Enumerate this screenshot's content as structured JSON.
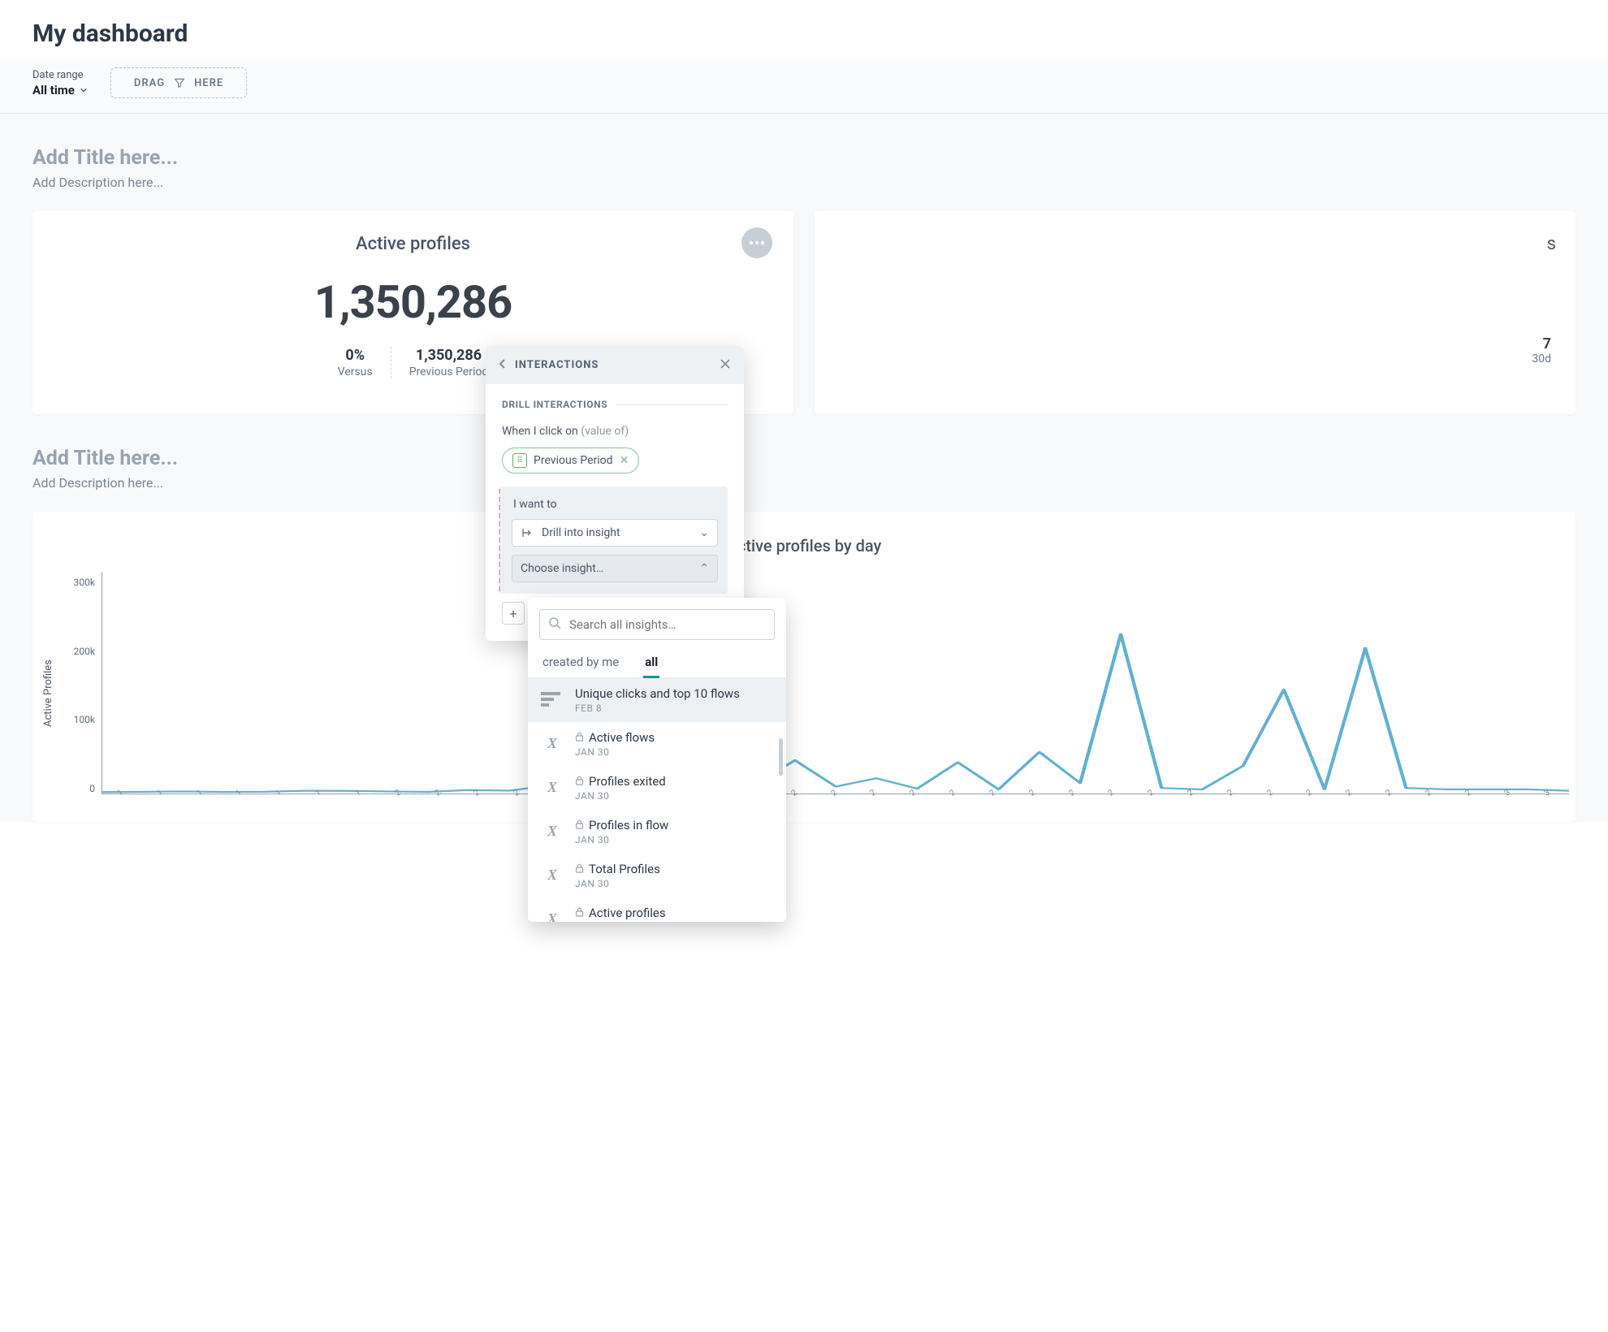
{
  "header": {
    "title": "My dashboard"
  },
  "filters": {
    "date_range_label": "Date range",
    "date_range_value": "All time",
    "drag_left": "DRAG",
    "drag_right": "HERE"
  },
  "section1": {
    "title_placeholder": "Add Title here...",
    "desc_placeholder": "Add Description here..."
  },
  "kpi_card": {
    "title": "Active profiles",
    "value": "1,350,286",
    "versus_pct": "0%",
    "versus_label": "Versus",
    "prev_value": "1,350,286",
    "prev_label": "Previous Period"
  },
  "kpi_card2": {
    "title_suffix": "s",
    "num_right": "7",
    "label_right": "30d"
  },
  "section2": {
    "title_placeholder": "Add Title here...",
    "desc_placeholder": "Add Description here..."
  },
  "chart_title": "Active profiles by day",
  "chart_y_label": "Active Profiles",
  "popover": {
    "title": "INTERACTIONS",
    "section_label": "DRILL INTERACTIONS",
    "when_text": "When I click on",
    "when_muted": "(value of)",
    "chip_label": "Previous Period",
    "i_want_to": "I want to",
    "action_value": "Drill into insight",
    "choose_label": "Choose insight…"
  },
  "dropdown": {
    "search_placeholder": "Search all insights…",
    "tab1": "created by me",
    "tab2": "all",
    "items": [
      {
        "icon": "bars",
        "name": "Unique clicks and top 10 flows",
        "date": "FEB 8",
        "locked": false,
        "selected": true
      },
      {
        "icon": "x",
        "name": "Active flows",
        "date": "JAN 30",
        "locked": true,
        "selected": false
      },
      {
        "icon": "x",
        "name": "Profiles exited",
        "date": "JAN 30",
        "locked": true,
        "selected": false
      },
      {
        "icon": "x",
        "name": "Profiles in flow",
        "date": "JAN 30",
        "locked": true,
        "selected": false
      },
      {
        "icon": "x",
        "name": "Total Profiles",
        "date": "JAN 30",
        "locked": true,
        "selected": false
      },
      {
        "icon": "x",
        "name": "Active profiles",
        "date": "",
        "locked": true,
        "selected": false
      }
    ]
  },
  "chart_data": {
    "type": "line",
    "title": "Active profiles by day",
    "xlabel": "",
    "ylabel": "Active Profiles",
    "ylim": [
      0,
      320000
    ],
    "y_ticks": [
      "300k",
      "200k",
      "100k",
      "0"
    ],
    "x_tick_codes": [
      "1",
      "1",
      "1",
      "1",
      "1",
      "1",
      "1",
      "2",
      "2",
      "2",
      "2",
      "2",
      "2",
      "2",
      "2",
      "2",
      "2",
      "2",
      "2",
      "2",
      "2",
      "2",
      "2",
      "2",
      "2",
      "2",
      "2",
      "2",
      "2",
      "2",
      "2",
      "2",
      "2",
      "2",
      "2",
      "3",
      "3"
    ],
    "series": [
      {
        "name": "Active Profiles",
        "values": [
          2000,
          2500,
          3000,
          2200,
          2600,
          4000,
          3800,
          3000,
          2400,
          5000,
          4200,
          12000,
          8000,
          6000,
          160000,
          22000,
          12000,
          48000,
          10000,
          22000,
          7000,
          45000,
          6000,
          60000,
          15000,
          230000,
          8000,
          6000,
          40000,
          150000,
          6000,
          210000,
          8000,
          6000,
          6000,
          6000,
          4000
        ]
      }
    ]
  }
}
